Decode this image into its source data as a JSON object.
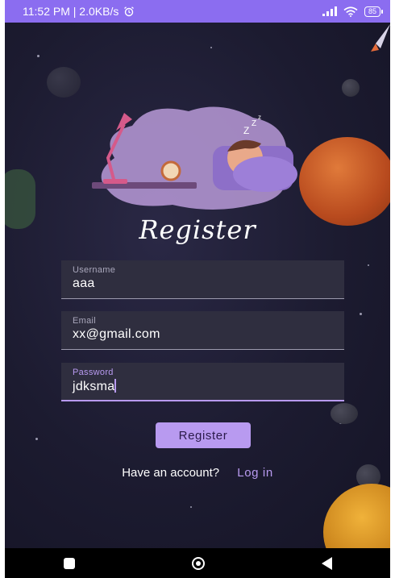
{
  "status_bar": {
    "time_speed": "11:52 PM | 2.0KB/s",
    "battery": "85"
  },
  "screen": {
    "title": "Register"
  },
  "form": {
    "username": {
      "label": "Username",
      "value": "aaa"
    },
    "email": {
      "label": "Email",
      "value": "xx@gmail.com"
    },
    "password": {
      "label": "Password",
      "value": "jdksma"
    }
  },
  "actions": {
    "register_label": "Register",
    "have_account_text": "Have an account?",
    "login_label": "Log in"
  },
  "colors": {
    "status_bar": "#8b6df0",
    "background": "#1b1a2e",
    "accent": "#b89af0",
    "field_bg": "#2f2e3f"
  },
  "icons": {
    "status": [
      "alarm-icon",
      "signal-icon",
      "wifi-icon",
      "battery-icon"
    ],
    "nav": [
      "recents-icon",
      "home-icon",
      "back-icon"
    ]
  }
}
